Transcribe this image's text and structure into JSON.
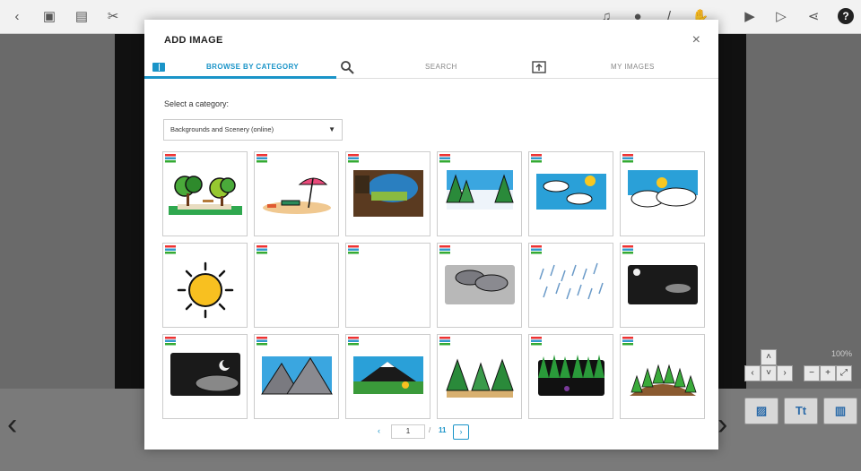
{
  "modal": {
    "title": "ADD IMAGE",
    "close": "×",
    "tabs": [
      {
        "label": "BROWSE BY CATEGORY"
      },
      {
        "label": "SEARCH"
      },
      {
        "label": "MY IMAGES"
      }
    ],
    "category_label": "Select a category:",
    "category_value": "Backgrounds and Scenery (online)",
    "pagination": {
      "prev": "‹",
      "current": "1",
      "separator": "/",
      "total": "11",
      "next": "›"
    }
  },
  "stage": {
    "zoom": "100%"
  },
  "colors": {
    "accent": "#1a94c8"
  },
  "tiles": [
    {
      "icon": "park-trees-image"
    },
    {
      "icon": "beach-umbrella-image"
    },
    {
      "icon": "cave-image"
    },
    {
      "icon": "snowy-pines-image"
    },
    {
      "icon": "blue-sky-clouds-image"
    },
    {
      "icon": "cloudy-sky-image"
    },
    {
      "icon": "sun-image"
    },
    {
      "icon": "blank-image"
    },
    {
      "icon": "blank-image"
    },
    {
      "icon": "storm-clouds-image"
    },
    {
      "icon": "rain-image"
    },
    {
      "icon": "night-sky-image"
    },
    {
      "icon": "night-moon-clouds-image"
    },
    {
      "icon": "rocky-mountains-image"
    },
    {
      "icon": "mountain-meadow-image"
    },
    {
      "icon": "forest-trees-image"
    },
    {
      "icon": "dark-forest-image"
    },
    {
      "icon": "tree-hill-image"
    }
  ]
}
